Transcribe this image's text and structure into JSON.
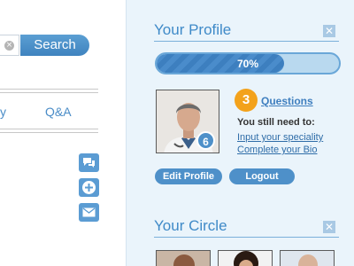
{
  "search": {
    "button_label": "Search",
    "clear_icon": "×"
  },
  "nav": {
    "tab_partial": "y",
    "tab_qa": "Q&A"
  },
  "side_icons": [
    "chat-icon",
    "plus-icon",
    "mail-icon"
  ],
  "profile": {
    "title": "Your Profile",
    "close": "✕",
    "progress": {
      "value": 0.7,
      "label": "70%"
    },
    "photo_badge": "6",
    "questions_count": "3",
    "questions_label": "Questions",
    "need_label": "You still need to:",
    "todo": [
      "Input your speciality",
      "Complete your Bio"
    ],
    "edit_label": "Edit Profile",
    "logout_label": "Logout"
  },
  "circle": {
    "title": "Your Circle",
    "close": "✕"
  },
  "colors": {
    "accent": "#4e90c9",
    "panel_bg": "#eaf4fb",
    "orange": "#f3a21b"
  }
}
